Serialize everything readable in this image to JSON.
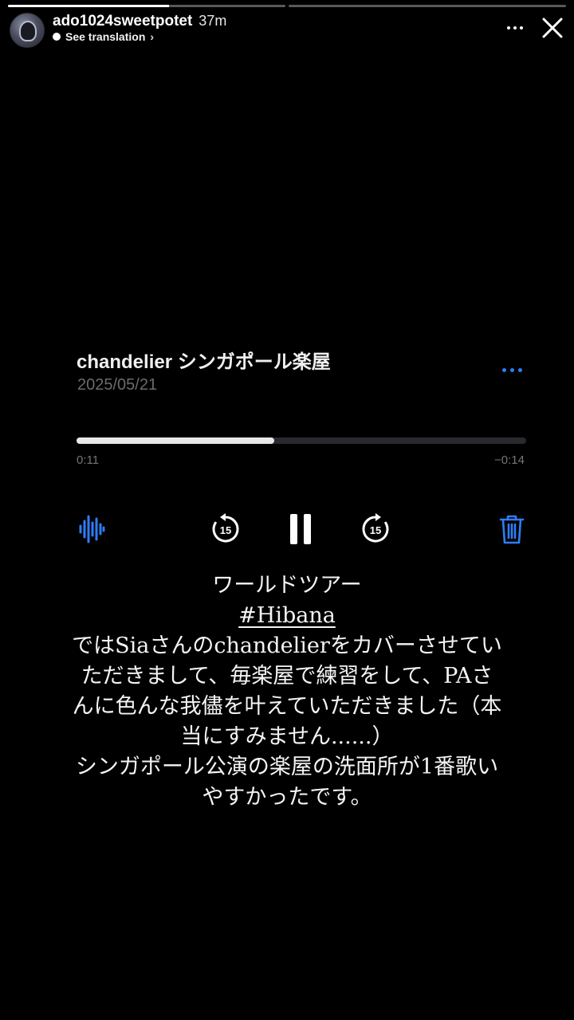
{
  "story": {
    "progress_segments": [
      0.58,
      0
    ]
  },
  "header": {
    "username": "ado1024sweetpotet",
    "time_ago": "37m",
    "translation": "See translation",
    "translation_chevron": "›"
  },
  "player": {
    "title": "chandelier シンガポール楽屋",
    "date": "2025/05/21",
    "progress": 0.44,
    "elapsed": "0:11",
    "remaining": "−0:14",
    "skip_seconds": "15",
    "accent_color": "#2f7df6"
  },
  "caption": {
    "line1": "ワールドツアー",
    "hashtag": "#Hibana",
    "body": "ではSiaさんのchandelierをカバーさせていただきまして、毎楽屋で練習をして、PAさんに色んな我儘を叶えていただきました（本当にすみません......）",
    "body2": "シンガポール公演の楽屋の洗面所が1番歌いやすかったです。"
  }
}
